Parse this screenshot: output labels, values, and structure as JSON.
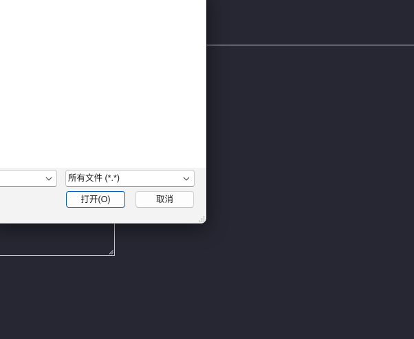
{
  "dialog": {
    "filename_combo": {
      "value": ""
    },
    "filetype_combo": {
      "value": "所有文件 (*.*)"
    },
    "open_button": "打开(O)",
    "cancel_button": "取消"
  },
  "colors": {
    "desktop_background": "#272733",
    "dialog_footer": "#f3f3f3",
    "primary_button_border": "#005fb8"
  },
  "icons": [
    "chevron-down-icon",
    "resize-grip-icon"
  ]
}
